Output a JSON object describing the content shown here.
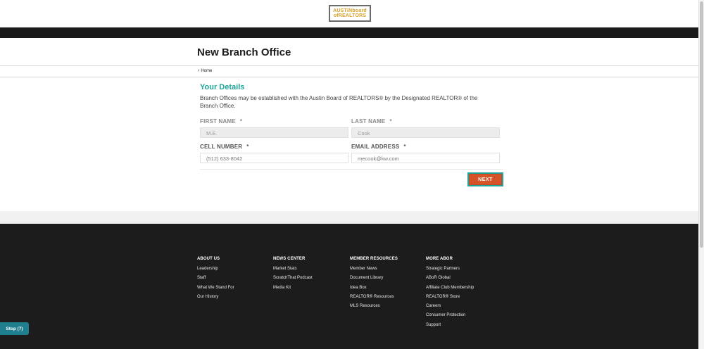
{
  "header": {
    "logo_line1": "AUSTINboard",
    "logo_line2": "ofREALTORS"
  },
  "page": {
    "title": "New Branch Office",
    "breadcrumb": "Home"
  },
  "form": {
    "section_title": "Your Details",
    "description": "Branch Offices may be established with the Austin Board of REALTORS® by the Designated REALTOR® of the Branch Office.",
    "required_mark": "*",
    "fields": {
      "first_name": {
        "label": "FIRST NAME",
        "value": "M.E."
      },
      "last_name": {
        "label": "LAST NAME",
        "value": "Cook"
      },
      "cell_number": {
        "label": "CELL NUMBER",
        "placeholder": "(512) 633-8042"
      },
      "email": {
        "label": "EMAIL ADDRESS",
        "placeholder": "mecook@kw.com"
      }
    },
    "next_label": "NEXT"
  },
  "footer": {
    "columns": [
      {
        "heading": "ABOUT US",
        "links": [
          "Leadership",
          "Staff",
          "What We Stand For",
          "Our History"
        ]
      },
      {
        "heading": "NEWS CENTER",
        "links": [
          "Market Stats",
          "ScratchThat Podcast",
          "Media Kit"
        ]
      },
      {
        "heading": "MEMBER RESOURCES",
        "links": [
          "Member News",
          "Document Library",
          "Idea Box",
          "REALTOR® Resources",
          "MLS Resources"
        ]
      },
      {
        "heading": "MORE ABOR",
        "links": [
          "Strategic Partners",
          "ABoR Global",
          "Affiliate Club Membership",
          "REALTOR® Store",
          "Careers",
          "Consumer Protection",
          "Support"
        ]
      }
    ]
  },
  "stop_button": "Stop (7)",
  "colors": {
    "accent": "#1fa39a",
    "button": "#d6532a",
    "footer_bg": "#1c1c1c"
  }
}
